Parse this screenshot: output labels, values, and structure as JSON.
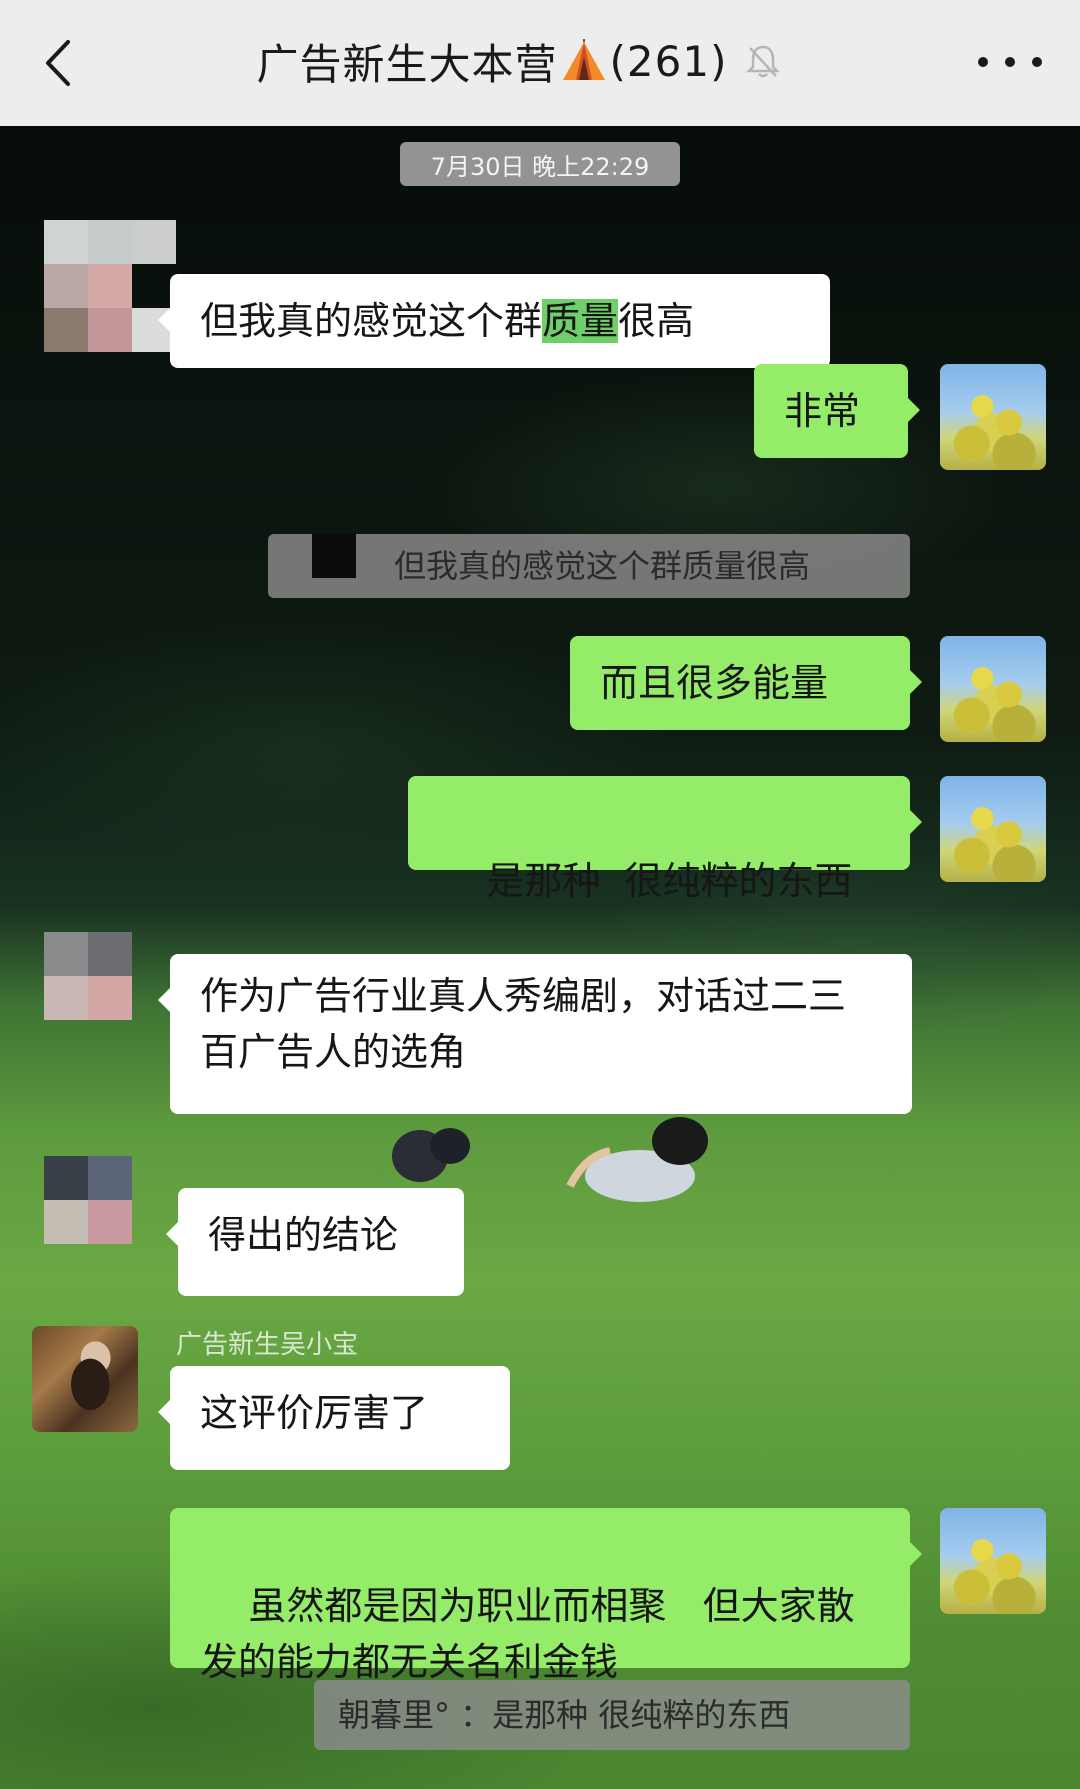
{
  "header": {
    "title": "广告新生大本营",
    "member_count": "(261)",
    "icons": {
      "back": "chevron-left-icon",
      "tent": "tent-icon",
      "mute": "bell-muted-icon",
      "more": "more-dots-icon"
    }
  },
  "chat": {
    "timestamp": "7月30日 晚上22:29",
    "messages": [
      {
        "side": "left",
        "pre": "但我真的感觉这个群",
        "highlight": "质量",
        "post": "很高"
      },
      {
        "side": "right",
        "text": "非常"
      },
      {
        "quote": "但我真的感觉这个群质量很高"
      },
      {
        "side": "right",
        "text": "而且很多能量"
      },
      {
        "side": "right",
        "text": "是那种  很纯粹的东西"
      },
      {
        "side": "left",
        "text": "作为广告行业真人秀编剧，对话过二三百广告人的选角"
      },
      {
        "side": "left",
        "text": "得出的结论"
      },
      {
        "side": "left",
        "sender": "广告新生吴小宝",
        "text": "这评价厉害了"
      },
      {
        "side": "right",
        "text": "虽然都是因为职业而相聚   但大家散发的能力都无关名利金钱"
      },
      {
        "quote": "朝暮里° ：是那种  很纯粹的东西"
      }
    ]
  },
  "colors": {
    "header_bg": "#ededed",
    "bubble_green": "#95ec69",
    "bubble_white": "#ffffff",
    "timestamp_bg": "#aaaaaa"
  }
}
